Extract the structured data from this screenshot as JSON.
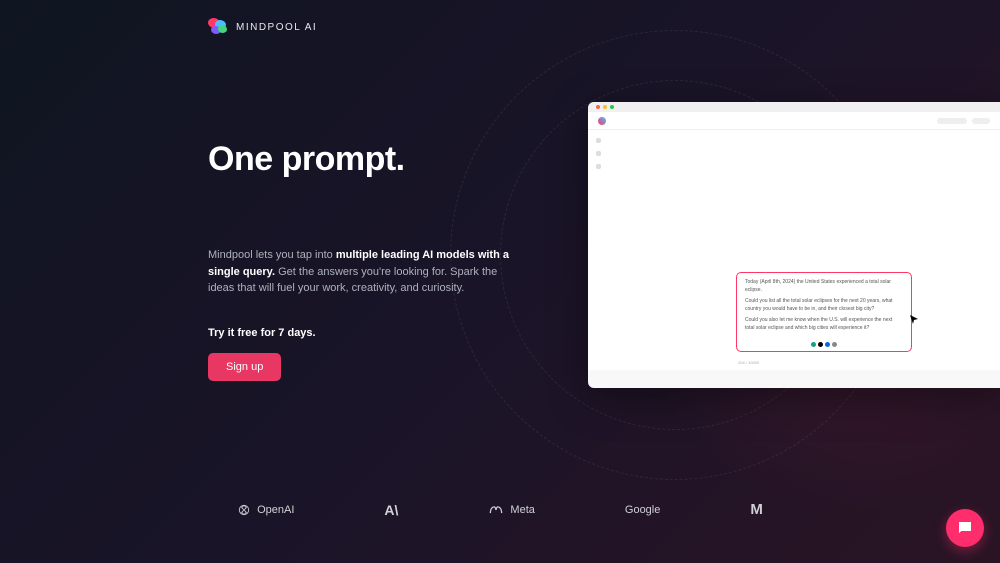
{
  "brand": {
    "name": "MINDPOOL AI"
  },
  "hero": {
    "headline": "One prompt.",
    "description_pre": "Mindpool lets you tap into ",
    "description_bold": "multiple leading AI models with a single query.",
    "description_post": " Get the answers you're looking for. Spark the ideas that will fuel your work, creativity, and curiosity.",
    "trial_text": "Try it free for 7 days.",
    "signup_label": "Sign up"
  },
  "mockup": {
    "prompt_line1": "Today (April 8th, 2024) the United States experienced a total solar eclipse.",
    "prompt_line2": "Could you list all the total solar eclipses for the next 20 years, what country you would have to be in, and their closest big city?",
    "prompt_line3": "Could you also let me know when the U.S. will experience the next total solar eclipse and which big cities will experience it?",
    "footer_text": "204 / 10000"
  },
  "partners": [
    "OpenAI",
    "A\\",
    "Meta",
    "Google",
    "M"
  ]
}
